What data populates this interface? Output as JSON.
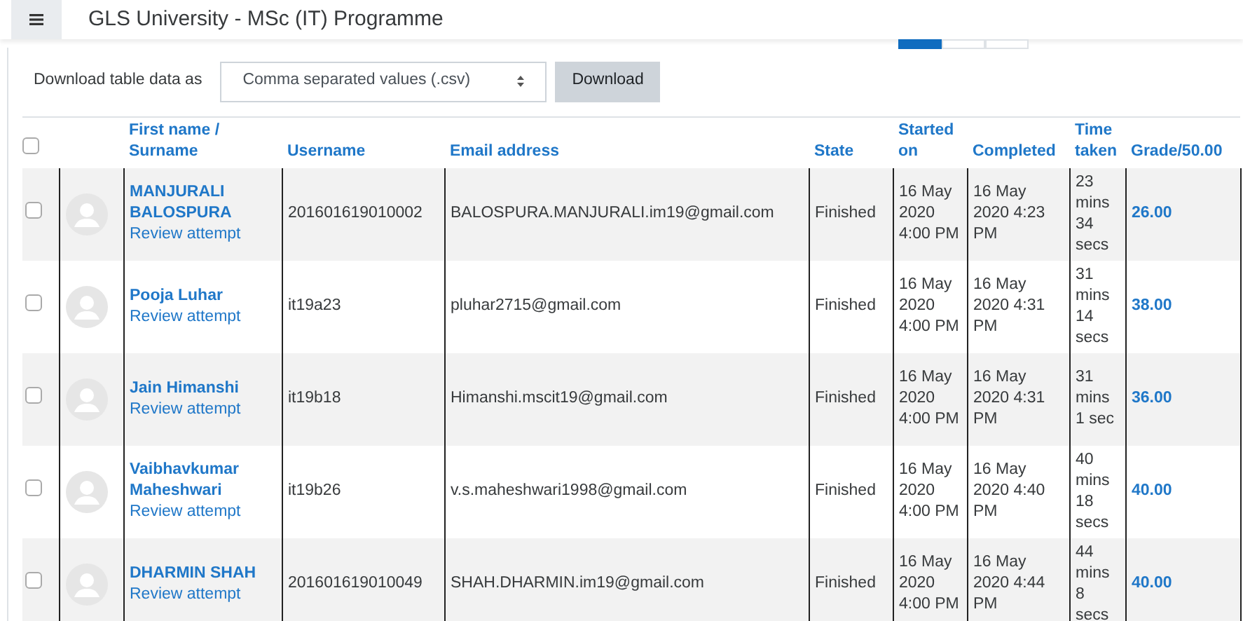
{
  "header": {
    "title": "GLS University - MSc (IT) Programme"
  },
  "pagination": [
    {
      "selected": true
    },
    {
      "selected": false
    },
    {
      "selected": false
    }
  ],
  "download": {
    "label": "Download table data as",
    "format": "Comma separated values (.csv)",
    "button": "Download"
  },
  "table": {
    "select_all": {
      "checked": false
    },
    "columns": [
      "First name / Surname",
      "Username",
      "Email address",
      "State",
      "Started on",
      "Completed",
      "Time taken",
      "Grade/50.00"
    ],
    "rows": [
      {
        "checked": false,
        "name": "MANJURALI BALOSPURA",
        "review": "Review attempt",
        "username": "201601619010002",
        "email": "BALOSPURA.MANJURALI.im19@gmail.com",
        "state": "Finished",
        "started": "16 May 2020 4:00 PM",
        "completed": "16 May 2020 4:23 PM",
        "time_taken": "23 mins 34 secs",
        "grade": "26.00"
      },
      {
        "checked": false,
        "name": "Pooja Luhar",
        "review": "Review attempt",
        "username": "it19a23",
        "email": "pluhar2715@gmail.com",
        "state": "Finished",
        "started": "16 May 2020 4:00 PM",
        "completed": "16 May 2020 4:31 PM",
        "time_taken": "31 mins 14 secs",
        "grade": "38.00"
      },
      {
        "checked": false,
        "name": "Jain Himanshi",
        "review": "Review attempt",
        "username": "it19b18",
        "email": "Himanshi.mscit19@gmail.com",
        "state": "Finished",
        "started": "16 May 2020 4:00 PM",
        "completed": "16 May 2020 4:31 PM",
        "time_taken": "31 mins 1 sec",
        "grade": "36.00"
      },
      {
        "checked": false,
        "name": "Vaibhavkumar Maheshwari",
        "review": "Review attempt",
        "username": "it19b26",
        "email": "v.s.maheshwari1998@gmail.com",
        "state": "Finished",
        "started": "16 May 2020 4:00 PM",
        "completed": "16 May 2020 4:40 PM",
        "time_taken": "40 mins 18 secs",
        "grade": "40.00"
      },
      {
        "checked": false,
        "name": "DHARMIN SHAH",
        "review": "Review attempt",
        "username": "201601619010049",
        "email": "SHAH.DHARMIN.im19@gmail.com",
        "state": "Finished",
        "started": "16 May 2020 4:00 PM",
        "completed": "16 May 2020 4:44 PM",
        "time_taken": "44 mins 8 secs",
        "grade": "40.00"
      }
    ]
  }
}
